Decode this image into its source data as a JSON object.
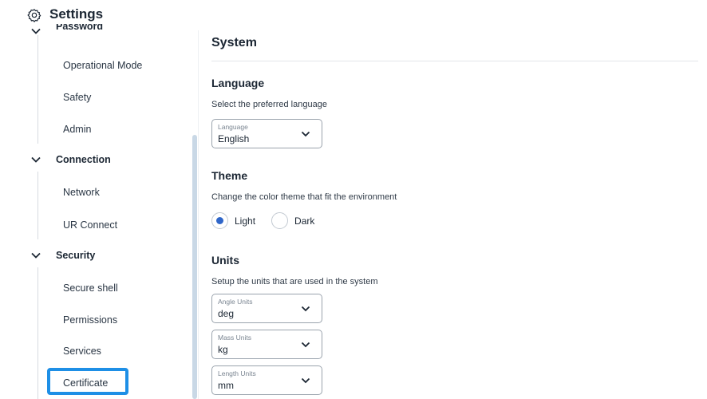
{
  "header": {
    "title": "Settings",
    "icon": "gear-icon"
  },
  "sidebar": {
    "groups": [
      {
        "label": "Password",
        "items": [
          "Operational Mode",
          "Safety",
          "Admin"
        ]
      },
      {
        "label": "Connection",
        "items": [
          "Network",
          "UR Connect"
        ]
      },
      {
        "label": "Security",
        "items": [
          "Secure shell",
          "Permissions",
          "Services",
          "Certificate"
        ]
      }
    ],
    "selected_item": "Certificate",
    "accent_color": "#1e8fe6"
  },
  "main": {
    "title": "System",
    "language": {
      "heading": "Language",
      "description": "Select the preferred language",
      "select_label": "Language",
      "select_value": "English"
    },
    "theme": {
      "heading": "Theme",
      "description": "Change the color theme that fit the environment",
      "options": [
        "Light",
        "Dark"
      ],
      "selected": "Light"
    },
    "units": {
      "heading": "Units",
      "description": "Setup the units that are used in the system",
      "selects": [
        {
          "label": "Angle Units",
          "value": "deg"
        },
        {
          "label": "Mass Units",
          "value": "kg"
        },
        {
          "label": "Length Units",
          "value": "mm"
        }
      ]
    }
  }
}
